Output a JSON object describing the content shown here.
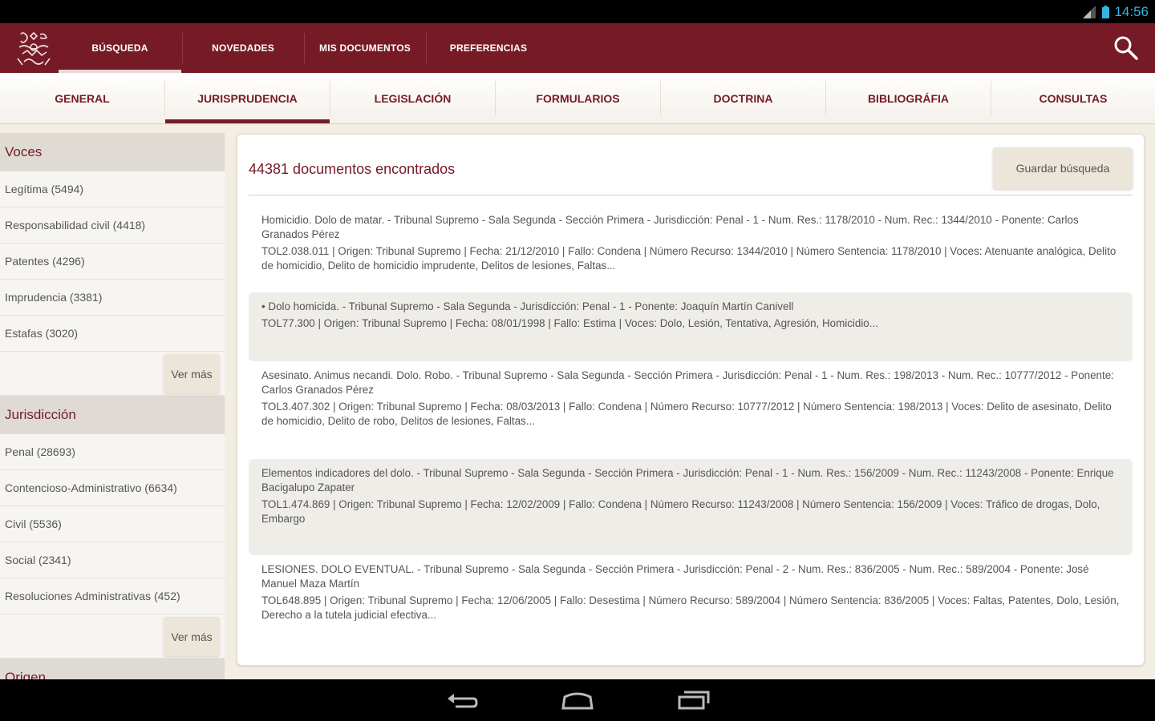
{
  "status_bar": {
    "time": "14:56"
  },
  "top_tabs": [
    {
      "label": "BÚSQUEDA",
      "active": true
    },
    {
      "label": "NOVEDADES",
      "active": false
    },
    {
      "label": "MIS DOCUMENTOS",
      "active": false
    },
    {
      "label": "PREFERENCIAS",
      "active": false
    }
  ],
  "sub_tabs": [
    {
      "label": "GENERAL",
      "active": false
    },
    {
      "label": "JURISPRUDENCIA",
      "active": true
    },
    {
      "label": "LEGISLACIÓN",
      "active": false
    },
    {
      "label": "FORMULARIOS",
      "active": false
    },
    {
      "label": "DOCTRINA",
      "active": false
    },
    {
      "label": "BIBLIOGRÁFIA",
      "active": false
    },
    {
      "label": "CONSULTAS",
      "active": false
    }
  ],
  "sidebar": {
    "sections": [
      {
        "title": "Voces",
        "items": [
          "Legítima (5494)",
          "Responsabilidad civil (4418)",
          "Patentes (4296)",
          "Imprudencia (3381)",
          "Estafas (3020)"
        ],
        "more_label": "Ver más"
      },
      {
        "title": "Jurisdicción",
        "items": [
          "Penal (28693)",
          "Contencioso-Administrativo (6634)",
          "Civil (5536)",
          "Social (2341)",
          "Resoluciones Administrativas (452)"
        ],
        "more_label": "Ver más"
      }
    ],
    "next_section_title": "Origen"
  },
  "main": {
    "result_count": "44381 documentos encontrados",
    "save_search_label": "Guardar búsqueda",
    "results": [
      {
        "title": "Homicidio. Dolo de matar. - Tribunal Supremo - Sala Segunda - Sección Primera - Jurisdicción: Penal - 1 - Num. Res.: 1178/2010 - Num. Rec.: 1344/2010 - Ponente: Carlos Granados Pérez",
        "details": "TOL2.038.011 | Origen: Tribunal Supremo | Fecha: 21/12/2010 | Fallo: Condena | Número Recurso: 1344/2010 | Número Sentencia: 1178/2010 | Voces: Atenuante analógica, Delito de homicidio, Delito de homicidio imprudente, Delitos de lesiones, Faltas..."
      },
      {
        "title": "• Dolo homicida. - Tribunal Supremo - Sala Segunda - Jurisdicción: Penal - 1 - Ponente: Joaquín Martín Canivell",
        "details": "TOL77.300 | Origen: Tribunal Supremo | Fecha: 08/01/1998 | Fallo: Estima | Voces: Dolo, Lesión, Tentativa, Agresión, Homicidio..."
      },
      {
        "title": "Asesinato. Animus necandi. Dolo. Robo. - Tribunal Supremo - Sala Segunda - Sección Primera - Jurisdicción: Penal - 1 - Num. Res.: 198/2013 - Num. Rec.: 10777/2012 - Ponente: Carlos Granados Pérez",
        "details": "TOL3.407.302 | Origen: Tribunal Supremo | Fecha: 08/03/2013 | Fallo: Condena | Número Recurso: 10777/2012 | Número Sentencia: 198/2013 | Voces: Delito de asesinato, Delito de homicidio, Delito de robo, Delitos de lesiones, Faltas..."
      },
      {
        "title": "Elementos indicadores del dolo. - Tribunal Supremo - Sala Segunda - Sección Primera - Jurisdicción: Penal - 1 - Num. Res.: 156/2009 - Num. Rec.: 11243/2008 - Ponente: Enrique Bacigalupo Zapater",
        "details": "TOL1.474.869 | Origen: Tribunal Supremo | Fecha: 12/02/2009 | Fallo: Condena | Número Recurso: 11243/2008 | Número Sentencia: 156/2009 | Voces: Tráfico de drogas, Dolo, Embargo"
      },
      {
        "title": "LESIONES. DOLO EVENTUAL. - Tribunal Supremo - Sala Segunda - Sección Primera - Jurisdicción: Penal - 2 - Num. Res.: 836/2005 - Num. Rec.: 589/2004 - Ponente: José Manuel Maza Martín",
        "details": "TOL648.895 | Origen: Tribunal Supremo | Fecha: 12/06/2005 | Fallo: Desestima | Número Recurso: 589/2004 | Número Sentencia: 836/2005 | Voces: Faltas, Patentes, Dolo, Lesión, Derecho a la tutela judicial efectiva..."
      }
    ]
  }
}
